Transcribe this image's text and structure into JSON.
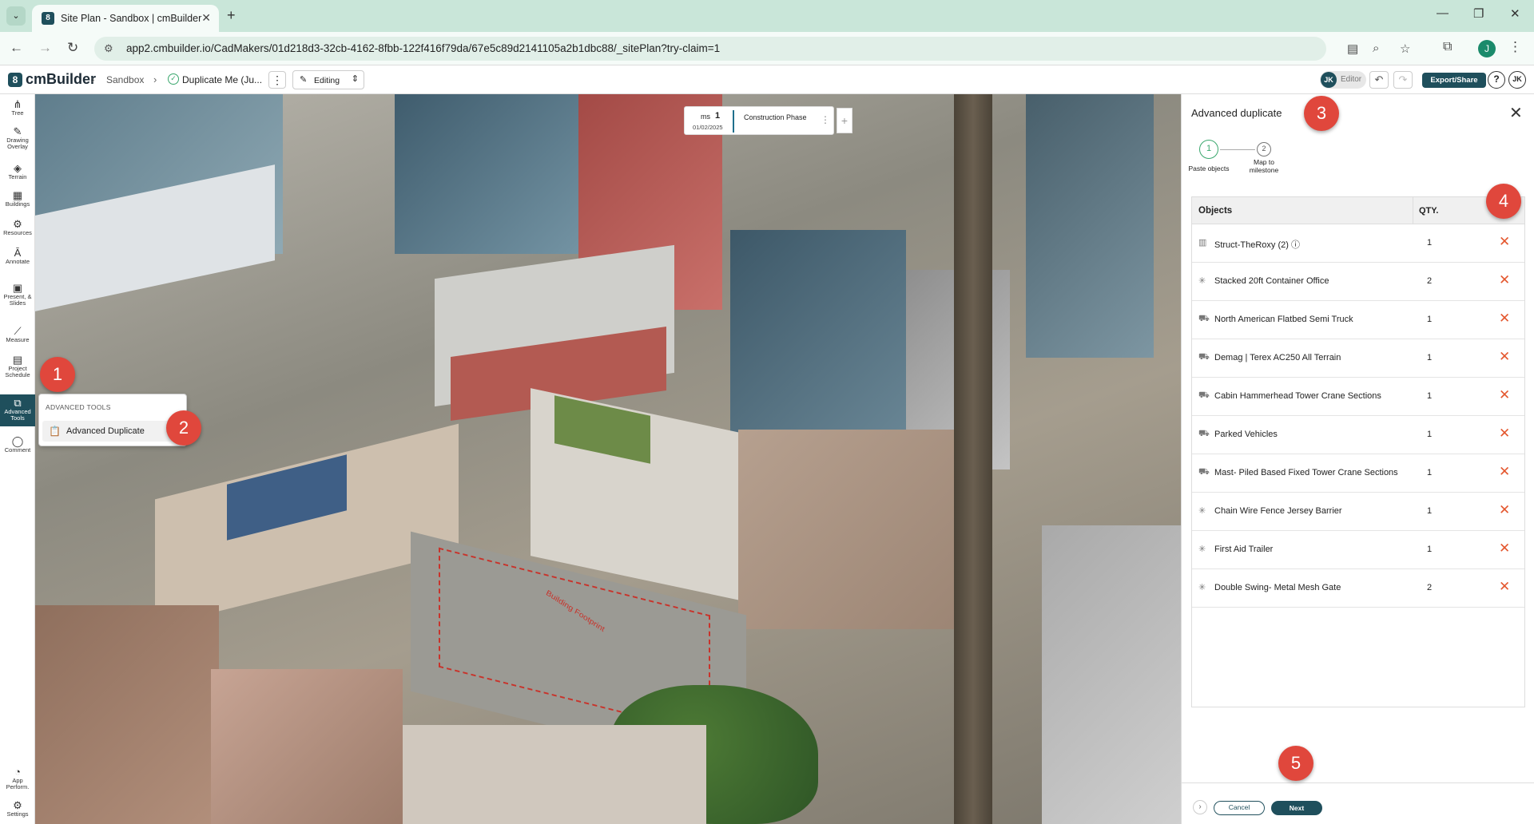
{
  "browser": {
    "tab_title": "Site Plan - Sandbox | cmBuilder",
    "favicon_letter": "8",
    "url": "app2.cmbuilder.io/CadMakers/01d218d3-32cb-4162-8fbb-122f416f79da/67e5c89d2141105a2b1dbc88/_sitePlan?try-claim=1",
    "profile_initial": "J"
  },
  "header": {
    "logo_mark": "8",
    "logo_text": "cmBuilder",
    "crumb_1": "Sandbox",
    "crumb_2": "Duplicate Me (Ju...",
    "mode": "Editing",
    "editor_initials": "JK",
    "editor_label": "Editor",
    "export_label": "Export/Share",
    "help": "?",
    "user_initials": "JK"
  },
  "rail": {
    "items": [
      {
        "icon": "tree-icon",
        "label": "Tree"
      },
      {
        "icon": "drawing-overlay-icon",
        "label": "Drawing Overlay"
      },
      {
        "icon": "terrain-icon",
        "label": "Terrain"
      },
      {
        "icon": "buildings-icon",
        "label": "Buildings"
      },
      {
        "icon": "resources-icon",
        "label": "Resources"
      },
      {
        "icon": "annotate-icon",
        "label": "Annotate"
      },
      {
        "icon": "present-icon",
        "label": "Present, & Slides"
      },
      {
        "icon": "measure-icon",
        "label": "Measure"
      },
      {
        "icon": "project-schedule-icon",
        "label": "Project Schedule"
      },
      {
        "icon": "advanced-tools-icon",
        "label": "Advanced Tools"
      },
      {
        "icon": "comment-icon",
        "label": "Comment"
      },
      {
        "icon": "app-performance-icon",
        "label": "App Perform."
      },
      {
        "icon": "settings-icon",
        "label": "Settings"
      }
    ]
  },
  "milestone": {
    "prefix": "ms",
    "number": "1",
    "date": "01/02/2025",
    "phase": "Construction Phase"
  },
  "map": {
    "footprint_label": "Building Footprint",
    "view_mode": "2D"
  },
  "advanced_tools": {
    "heading": "ADVANCED TOOLS",
    "item": "Advanced Duplicate"
  },
  "panel": {
    "title": "Advanced duplicate",
    "step_1_num": "1",
    "step_1_label": "Paste objects",
    "step_2_num": "2",
    "step_2_label": "Map to milestone",
    "col_objects": "Objects",
    "col_qty": "QTY.",
    "rows": [
      {
        "name": "Struct-TheRoxy (2) ⓘ",
        "qty": "1",
        "icon": "building-icon"
      },
      {
        "name": "Stacked 20ft Container Office",
        "qty": "2",
        "icon": "resource-icon"
      },
      {
        "name": "North American Flatbed Semi Truck",
        "qty": "1",
        "icon": "equipment-icon"
      },
      {
        "name": "Demag | Terex AC250 All Terrain",
        "qty": "1",
        "icon": "equipment-icon"
      },
      {
        "name": "Cabin Hammerhead Tower Crane Sections",
        "qty": "1",
        "icon": "equipment-icon"
      },
      {
        "name": "Parked Vehicles",
        "qty": "1",
        "icon": "equipment-icon"
      },
      {
        "name": "Mast- Piled Based Fixed Tower Crane Sections",
        "qty": "1",
        "icon": "equipment-icon"
      },
      {
        "name": "Chain Wire Fence Jersey Barrier",
        "qty": "1",
        "icon": "resource-icon"
      },
      {
        "name": "First Aid Trailer",
        "qty": "1",
        "icon": "resource-icon"
      },
      {
        "name": "Double Swing- Metal Mesh Gate",
        "qty": "2",
        "icon": "resource-icon"
      }
    ],
    "cancel_label": "Cancel",
    "next_label": "Next"
  },
  "callouts": [
    "1",
    "2",
    "3",
    "4",
    "5"
  ],
  "colors": {
    "brand": "#1f4f5c",
    "delete": "#e4572e",
    "callout": "#e0473c",
    "step_active": "#3aa76d"
  }
}
